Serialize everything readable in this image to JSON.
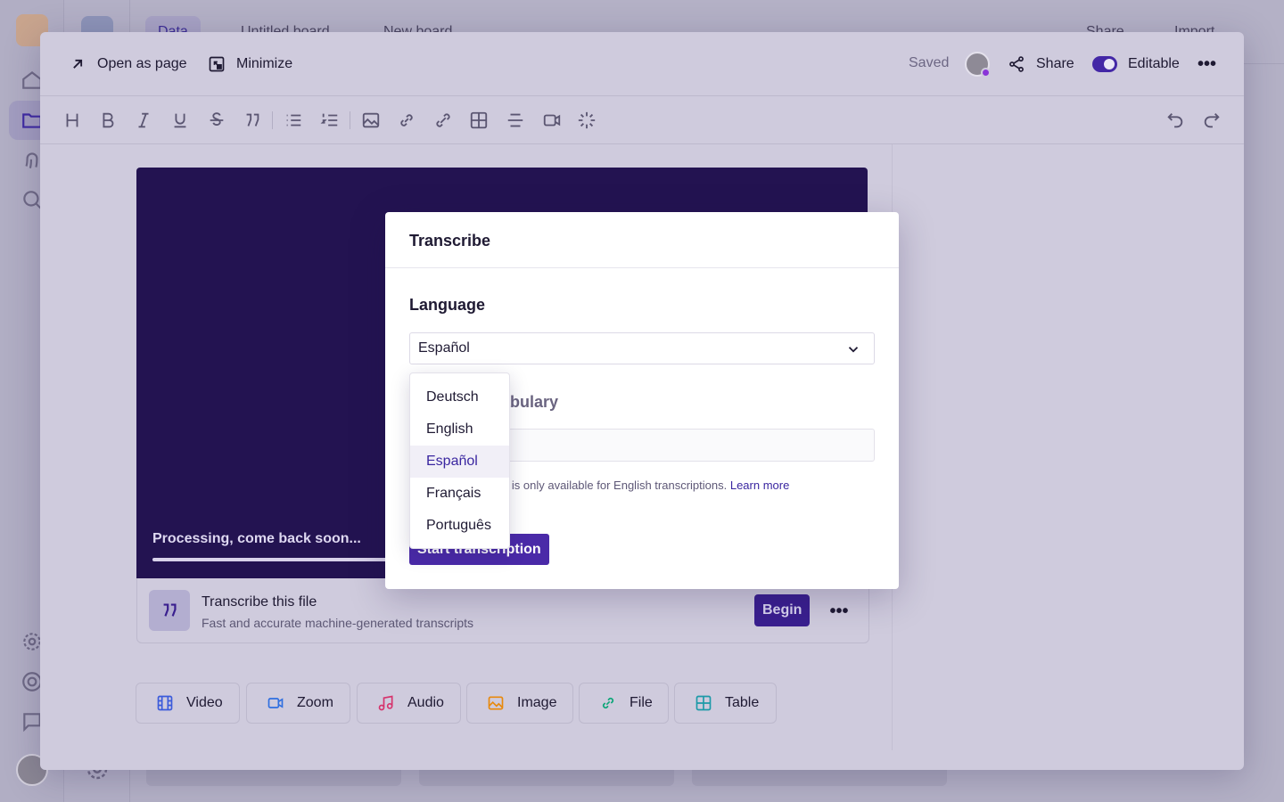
{
  "background": {
    "tabs": [
      "Data",
      "Untitled board",
      "New board"
    ],
    "header_actions": [
      "Share",
      "Import"
    ]
  },
  "window": {
    "open_as_page": "Open as page",
    "minimize": "Minimize",
    "saved": "Saved",
    "share": "Share",
    "editable": "Editable",
    "toolbar_icons": [
      "heading-icon",
      "bold-icon",
      "italic-icon",
      "underline-icon",
      "strikethrough-icon",
      "quote-icon",
      "bullet-list-icon",
      "numbered-list-icon",
      "image-icon",
      "link-icon",
      "embed-link-icon",
      "table-icon",
      "divider-icon",
      "video-icon",
      "magic-icon",
      "undo-icon",
      "redo-icon"
    ]
  },
  "video": {
    "status": "Processing, come back soon...",
    "progress": 0.34
  },
  "transcribe_row": {
    "title": "Transcribe this file",
    "subtitle": "Fast and accurate machine-generated transcripts",
    "begin": "Begin"
  },
  "chips": [
    {
      "label": "Video",
      "icon": "film-icon",
      "color": "#3b5bdb"
    },
    {
      "label": "Zoom",
      "icon": "camera-icon",
      "color": "#2f6fe0"
    },
    {
      "label": "Audio",
      "icon": "music-icon",
      "color": "#d6336c"
    },
    {
      "label": "Image",
      "icon": "image-icon",
      "color": "#e8890c"
    },
    {
      "label": "File",
      "icon": "link-icon",
      "color": "#0ca678"
    },
    {
      "label": "Table",
      "icon": "table-icon",
      "color": "#1c9aa8"
    }
  ],
  "dialog": {
    "title": "Transcribe",
    "language_label": "Language",
    "selected_language": "Español",
    "vocab_label": "Custom vocabulary",
    "vocab_note": "Custom vocabulary is only available for English transcriptions.",
    "learn_more": "Learn more",
    "start_button": "Start transcription"
  },
  "dropdown": {
    "options": [
      "Deutsch",
      "English",
      "Español",
      "Français",
      "Português"
    ],
    "selected": "Español"
  },
  "colors": {
    "accent": "#4a2aa8",
    "video_bg": "#231351"
  }
}
